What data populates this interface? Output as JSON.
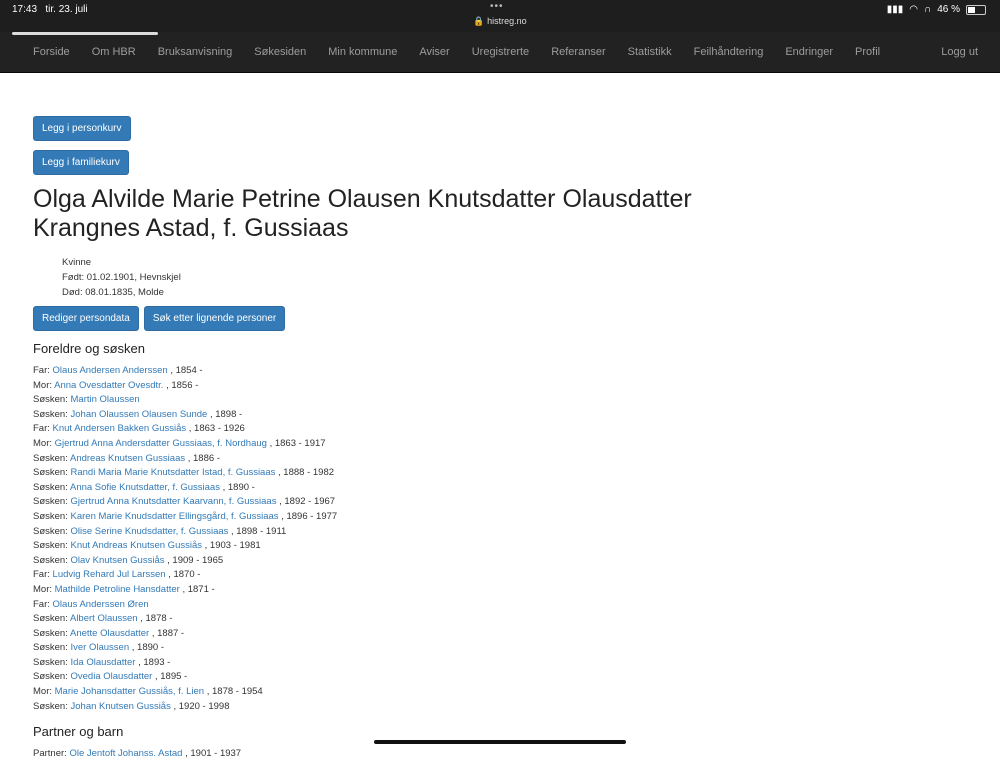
{
  "status": {
    "time": "17:43",
    "date": "tir. 23. juli",
    "url": "histreg.no",
    "battery": "46 %",
    "battery_level": 0.46
  },
  "nav": {
    "items": [
      "Forside",
      "Om HBR",
      "Bruksanvisning",
      "Søkesiden",
      "Min kommune",
      "Aviser",
      "Uregistrerte",
      "Referanser",
      "Statistikk",
      "Feilhåndtering",
      "Endringer",
      "Profil"
    ],
    "logout": "Logg ut"
  },
  "buttons": {
    "personkurv": "Legg i personkurv",
    "familiekurv": "Legg i familiekurv",
    "edit": "Rediger persondata",
    "similar": "Søk etter lignende personer"
  },
  "person": {
    "name_line1": "Olga Alvilde Marie Petrine Olausen Knutsdatter Olausdatter",
    "name_line2": "Krangnes Astad, f. Gussiaas",
    "gender": "Kvinne",
    "born": "Født: 01.02.1901, Hevnskjel",
    "died": "Død: 08.01.1835, Molde"
  },
  "parents_heading": "Foreldre og søsken",
  "relations": [
    {
      "role": "Far:",
      "name": "Olaus Andersen Anderssen",
      "years": ", 1854 -"
    },
    {
      "role": "Mor:",
      "name": "Anna Ovesdatter Ovesdtr.",
      "years": ", 1856 -"
    },
    {
      "role": "Søsken:",
      "name": "Martin Olaussen",
      "years": ""
    },
    {
      "role": "Søsken:",
      "name": "Johan Olaussen Olausen Sunde",
      "years": ", 1898 -"
    },
    {
      "role": "Far:",
      "name": "Knut Andersen Bakken Gussiås",
      "years": ", 1863 - 1926"
    },
    {
      "role": "Mor:",
      "name": "Gjertrud Anna Andersdatter Gussiaas, f. Nordhaug",
      "years": ", 1863 - 1917"
    },
    {
      "role": "Søsken:",
      "name": "Andreas Knutsen Gussiaas",
      "years": ", 1886 -"
    },
    {
      "role": "Søsken:",
      "name": "Randi Maria Marie Knutsdatter Istad, f. Gussiaas",
      "years": ", 1888 - 1982"
    },
    {
      "role": "Søsken:",
      "name": "Anna Sofie Knutsdatter, f. Gussiaas",
      "years": ", 1890 -"
    },
    {
      "role": "Søsken:",
      "name": "Gjertrud Anna Knutsdatter Kaarvann, f. Gussiaas",
      "years": ", 1892 - 1967"
    },
    {
      "role": "Søsken:",
      "name": "Karen Marie Knudsdatter Ellingsgård, f. Gussiaas",
      "years": ", 1896 - 1977"
    },
    {
      "role": "Søsken:",
      "name": "Olise Serine Knudsdatter, f. Gussiaas",
      "years": ", 1898 - 1911"
    },
    {
      "role": "Søsken:",
      "name": "Knut Andreas Knutsen Gussiås",
      "years": ", 1903 - 1981"
    },
    {
      "role": "Søsken:",
      "name": "Olav Knutsen Gussiås",
      "years": ", 1909 - 1965"
    },
    {
      "role": "Far:",
      "name": "Ludvig Rehard Jul Larssen",
      "years": ", 1870 -"
    },
    {
      "role": "Mor:",
      "name": "Mathilde Petroline Hansdatter",
      "years": ", 1871 -"
    },
    {
      "role": "Far:",
      "name": "Olaus Anderssen Øren",
      "years": ""
    },
    {
      "role": "Søsken:",
      "name": "Albert Olaussen",
      "years": ", 1878 -"
    },
    {
      "role": "Søsken:",
      "name": "Anette Olausdatter",
      "years": ", 1887 -"
    },
    {
      "role": "Søsken:",
      "name": "Iver Olaussen",
      "years": ", 1890 -"
    },
    {
      "role": "Søsken:",
      "name": "Ida Olausdatter",
      "years": ", 1893 -"
    },
    {
      "role": "Søsken:",
      "name": "Ovedia Olausdatter",
      "years": ", 1895 -"
    },
    {
      "role": "Mor:",
      "name": "Marie Johansdatter Gussiås, f. Lien",
      "years": ", 1878 - 1954"
    },
    {
      "role": "Søsken:",
      "name": "Johan Knutsen Gussiås",
      "years": ", 1920 - 1998"
    }
  ],
  "partner_heading": "Partner og barn",
  "partners": [
    {
      "role": "Partner:",
      "name": "Ole Jentoft Johanss. Astad",
      "years": ", 1901 - 1937"
    }
  ]
}
